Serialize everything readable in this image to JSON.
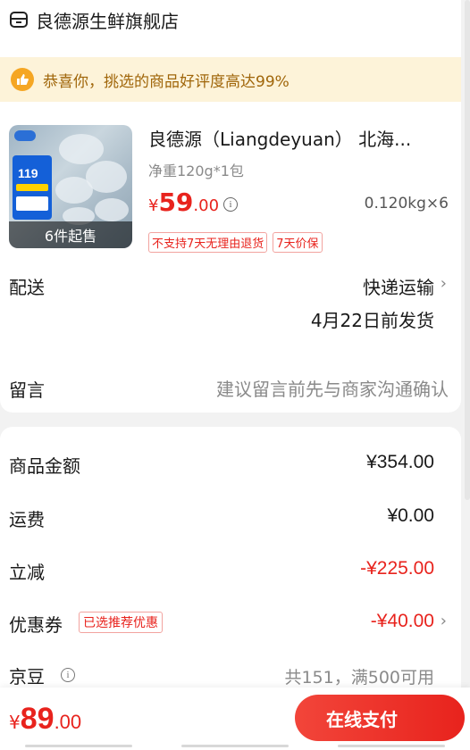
{
  "store": {
    "name": "良德源生鲜旗舰店",
    "icon": "store-icon"
  },
  "banner": {
    "text": "恭喜你，挑选的商品好评度高达99%",
    "icon": "thumbs-up-icon"
  },
  "product": {
    "title": "良德源（Liangdeyuan） 北海...",
    "spec": "净重120g*1包",
    "price_symbol": "¥",
    "price_int": "59",
    "price_dec": ".00",
    "weight_qty": "0.120kg×6",
    "image_caption": "6件起售",
    "image_badge_number": "119",
    "tags": [
      "不支持7天无理由退货",
      "7天价保"
    ]
  },
  "delivery": {
    "label": "配送",
    "method": "快递运输",
    "ship_date": "4月22日前发货"
  },
  "message": {
    "label": "留言",
    "placeholder": "建议留言前先与商家沟通确认"
  },
  "summary": {
    "goods_label": "商品金额",
    "goods_value": "¥354.00",
    "freight_label": "运费",
    "freight_value": "¥0.00",
    "discount_label": "立减",
    "discount_value": "-¥225.00",
    "coupon_label": "优惠券",
    "coupon_tag": "已选推荐优惠",
    "coupon_value": "-¥40.00",
    "jd_label": "京豆",
    "jd_detail": "共151，满500可用"
  },
  "footer": {
    "total_symbol": "¥",
    "total_int": "89",
    "total_dec": ".00",
    "pay_button": "在线支付"
  },
  "colors": {
    "accent_red": "#e8231d",
    "banner_bg": "#fdf3d9",
    "banner_text": "#a0660a",
    "banner_icon": "#f5a623"
  }
}
